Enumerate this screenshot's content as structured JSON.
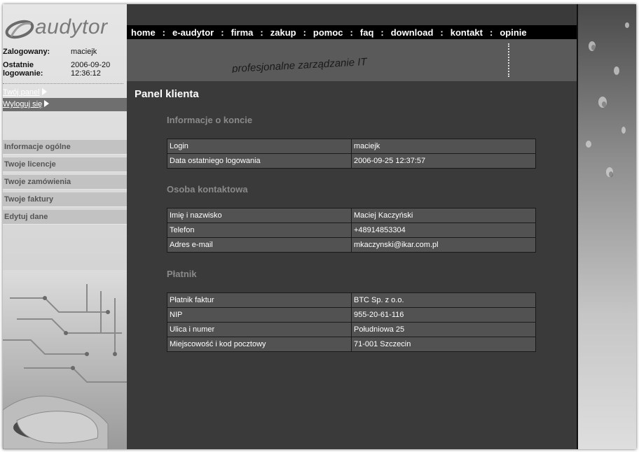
{
  "brand": {
    "logo_text": "audytor"
  },
  "user": {
    "logged_label": "Zalogowany:",
    "logged_value": "maciejk",
    "last_label_line1": "Ostatnie",
    "last_label_line2": "logowanie:",
    "last_value_date": "2006-09-20",
    "last_value_time": "12:36:12"
  },
  "sidebar": {
    "panel_link": "Twój panel",
    "logout_link": "Wyloguj się",
    "menu": [
      {
        "label": "Informacje ogólne"
      },
      {
        "label": "Twoje licencje"
      },
      {
        "label": "Twoje zamówienia"
      },
      {
        "label": "Twoje faktury"
      },
      {
        "label": "Edytuj dane"
      }
    ]
  },
  "nav": {
    "items": [
      {
        "label": "home"
      },
      {
        "label": "e-audytor"
      },
      {
        "label": "firma"
      },
      {
        "label": "zakup"
      },
      {
        "label": "pomoc"
      },
      {
        "label": "faq"
      },
      {
        "label": "download"
      },
      {
        "label": "kontakt"
      },
      {
        "label": "opinie"
      }
    ],
    "separator": ":"
  },
  "banner": {
    "slogan": "profesjonalne zarządzanie IT"
  },
  "main": {
    "title": "Panel klienta",
    "sections": [
      {
        "title": "Informacje o koncie",
        "rows": [
          {
            "label": "Login",
            "value": "maciejk"
          },
          {
            "label": "Data ostatniego logowania",
            "value": "2006-09-25 12:37:57"
          }
        ]
      },
      {
        "title": "Osoba kontaktowa",
        "rows": [
          {
            "label": "Imię i nazwisko",
            "value": "Maciej Kaczyński"
          },
          {
            "label": "Telefon",
            "value": "+48914853304"
          },
          {
            "label": "Adres e-mail",
            "value": "mkaczynski@ikar.com.pl"
          }
        ]
      },
      {
        "title": "Płatnik",
        "rows": [
          {
            "label": "Płatnik faktur",
            "value": "BTC Sp. z o.o."
          },
          {
            "label": "NIP",
            "value": "955-20-61-116"
          },
          {
            "label": "Ulica i numer",
            "value": "Południowa 25"
          },
          {
            "label": "Miejscowość i kod pocztowy",
            "value": "71-001 Szczecin"
          }
        ]
      }
    ]
  },
  "colors": {
    "background": "#3a3a3a",
    "nav_bar": "#000000",
    "table_cell": "#525252",
    "section_title": "#8a8a8a",
    "sidebar": "#d6d6d6"
  },
  "icons": [
    "audytor-logo-icon",
    "arrow-right-icon"
  ]
}
